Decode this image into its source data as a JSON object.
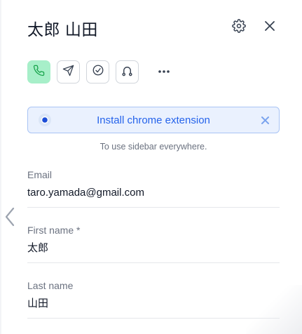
{
  "header": {
    "title": "太郎 山田",
    "settings_icon": "gear-icon",
    "close_icon": "close-icon"
  },
  "actions": [
    {
      "name": "call",
      "icon": "phone-icon",
      "accent": "#a7efc9"
    },
    {
      "name": "send",
      "icon": "send-icon"
    },
    {
      "name": "task",
      "icon": "check-circle-icon"
    },
    {
      "name": "sequence",
      "icon": "route-icon"
    },
    {
      "name": "more",
      "icon": "more-horizontal-icon"
    }
  ],
  "banner": {
    "text": "Install chrome extension",
    "subtext": "To use sidebar everywhere.",
    "icon": "chrome-icon",
    "accent": "#2563eb",
    "background": "#eaf1fe"
  },
  "fields": {
    "email": {
      "label": "Email",
      "value": "taro.yamada@gmail.com"
    },
    "first_name": {
      "label": "First name",
      "required_mark": "*",
      "value": "太郎"
    },
    "last_name": {
      "label": "Last name",
      "value": "山田"
    }
  },
  "nav": {
    "back_icon": "chevron-left-icon"
  }
}
